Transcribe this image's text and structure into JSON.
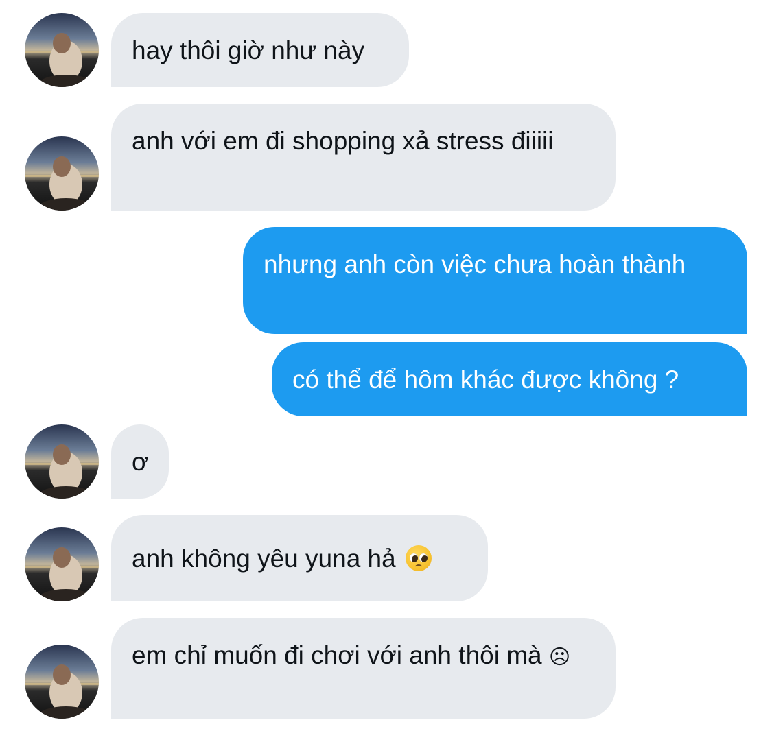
{
  "conversation": {
    "messages": [
      {
        "sender": "other",
        "text": "hay thôi giờ như này"
      },
      {
        "sender": "other",
        "text": "anh với em đi shopping xả stress điiiii"
      },
      {
        "sender": "me",
        "text": "nhưng anh còn việc chưa hoàn thành"
      },
      {
        "sender": "me",
        "text": "có thể để hôm khác được không ?"
      },
      {
        "sender": "other",
        "text": "ơ"
      },
      {
        "sender": "other",
        "text": "anh không yêu yuna hả",
        "emoji": "pleading-face-icon"
      },
      {
        "sender": "other",
        "text": "em chỉ muốn đi chơi với anh thôi mà",
        "emoji_text": "☹"
      }
    ]
  },
  "colors": {
    "incoming_bubble": "#e7eaee",
    "outgoing_bubble": "#1d9bf0",
    "incoming_text": "#0f1419",
    "outgoing_text": "#ffffff"
  }
}
